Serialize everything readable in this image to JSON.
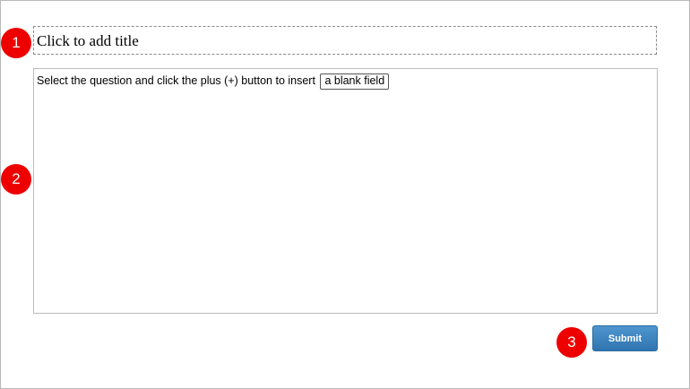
{
  "title_placeholder": "Click to add title",
  "question": {
    "text": "Select the question and click the plus (+) button to insert",
    "blank_field_label": "a blank field"
  },
  "submit_label": "Submit",
  "markers": [
    "1",
    "2",
    "3"
  ],
  "colors": {
    "marker": "#ee0000",
    "submit_button": "#3a82c0",
    "border": "#bcbcbc"
  }
}
